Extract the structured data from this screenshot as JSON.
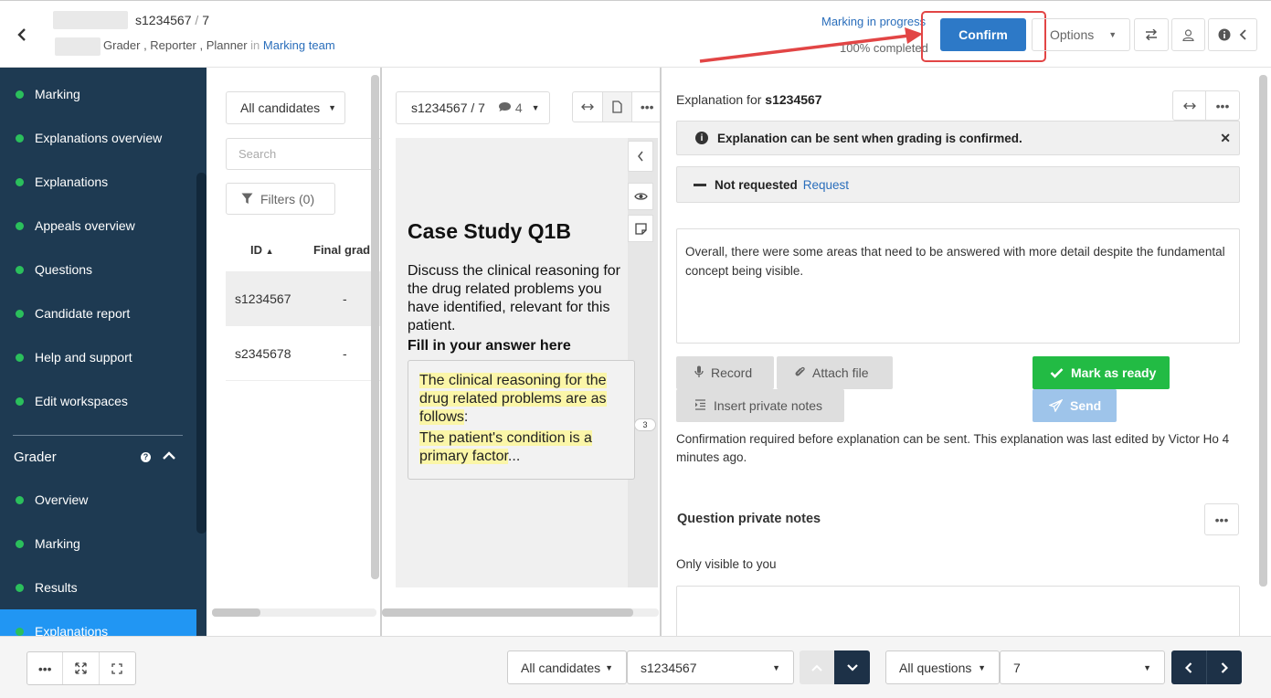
{
  "header": {
    "candidate_id": "s1234567",
    "question_no": "7",
    "roles": "Grader , Reporter , Planner",
    "roles_in": "in",
    "team": "Marking team",
    "status": "Marking in progress",
    "progress": "100% completed",
    "confirm_label": "Confirm",
    "options_label": "Options"
  },
  "sidebar": {
    "items": [
      {
        "label": "Marking"
      },
      {
        "label": "Explanations overview"
      },
      {
        "label": "Explanations"
      },
      {
        "label": "Appeals overview"
      },
      {
        "label": "Questions"
      },
      {
        "label": "Candidate report"
      },
      {
        "label": "Help and support"
      },
      {
        "label": "Edit workspaces"
      }
    ],
    "section_title": "Grader",
    "section_items": [
      {
        "label": "Overview"
      },
      {
        "label": "Marking"
      },
      {
        "label": "Results"
      },
      {
        "label": "Explanations"
      }
    ]
  },
  "candidates_panel": {
    "filter_label": "All candidates",
    "search_placeholder": "Search",
    "filters_label": "Filters (0)",
    "columns": [
      "ID",
      "Final grad"
    ],
    "rows": [
      {
        "id": "s1234567",
        "grade": "-"
      },
      {
        "id": "s2345678",
        "grade": "-"
      }
    ]
  },
  "answer_panel": {
    "select_label": "s1234567 / 7",
    "comment_count": "4",
    "title": "Case Study Q1B",
    "prompt": "Discuss the clinical reasoning for the drug related problems you have identified, relevant for this patient.",
    "fill_label": "Fill in your answer here",
    "answer_line1": "The clinical reasoning for the drug related problems are as follows",
    "answer_line1_end": ":",
    "answer_line2": "The patient's condition is a primary factor",
    "answer_line2_end": "...",
    "page_badge": "3"
  },
  "explanation_panel": {
    "heading_prefix": "Explanation for",
    "heading_id": "s1234567",
    "alert_text": "Explanation can be sent when grading is confirmed.",
    "request_status": "Not requested",
    "request_link": "Request",
    "explanation_text": "Overall, there were some areas that need to be answered with more detail despite the fundamental concept being visible.",
    "record_label": "Record",
    "attach_label": "Attach file",
    "private_notes_label": "Insert private notes",
    "mark_ready_label": "Mark as ready",
    "send_label": "Send",
    "confirm_note": "Confirmation required before explanation can be sent. This explanation was last edited by Victor Ho 4 minutes ago.",
    "qpn_title": "Question private notes",
    "qpn_sub": "Only visible to you"
  },
  "bottom_bar": {
    "candidates_filter": "All candidates",
    "candidate_value": "s1234567",
    "questions_filter": "All questions",
    "question_value": "7"
  },
  "colors": {
    "sidebar_bg": "#1e3a52",
    "active_item": "#2196f3",
    "confirm_btn": "#2d79c7",
    "mark_ready": "#22bb44",
    "highlight": "#e24545"
  }
}
